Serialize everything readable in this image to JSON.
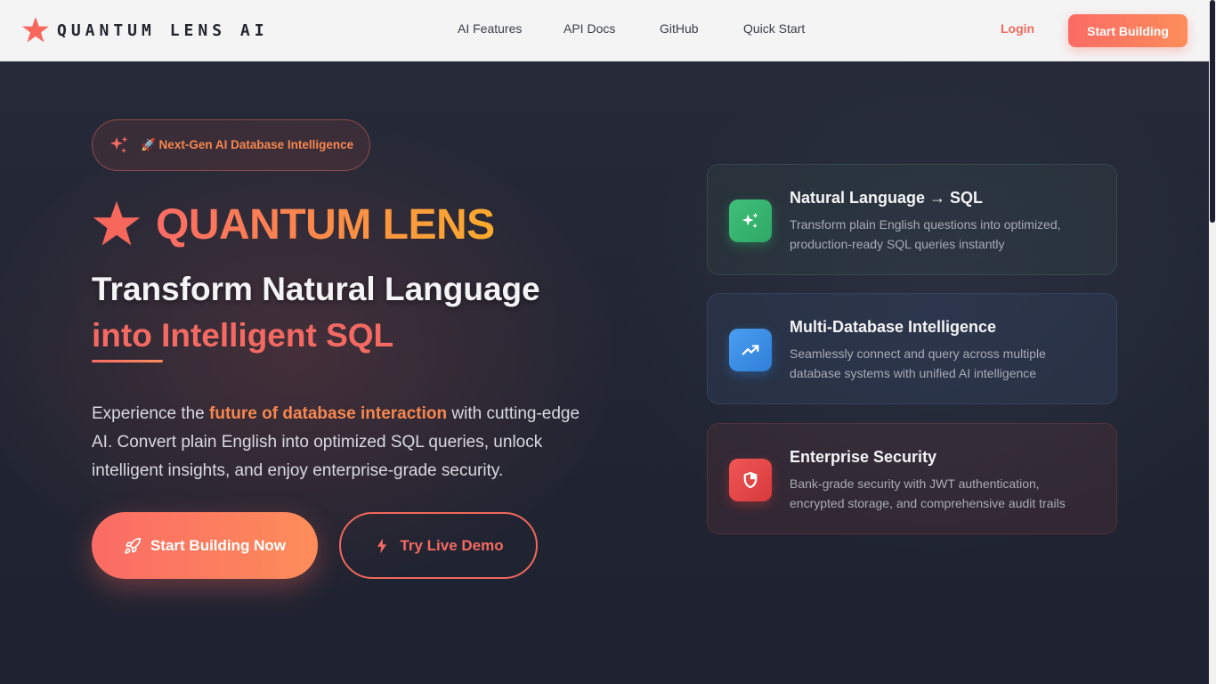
{
  "brand": {
    "name": "QUANTUM LENS AI"
  },
  "nav": {
    "links": [
      "AI Features",
      "API Docs",
      "GitHub",
      "Quick Start"
    ],
    "login": "Login",
    "cta": "Start Building"
  },
  "hero": {
    "badge": "🚀 Next-Gen AI Database Intelligence",
    "title": "QUANTUM LENS",
    "headline_line1": "Transform Natural Language",
    "headline_line2": "into Intelligent SQL",
    "desc_before": "Experience the ",
    "desc_highlight": "future of database interaction",
    "desc_after": " with cutting-edge AI. Convert plain English into optimized SQL queries, unlock intelligent insights, and enjoy enterprise-grade security.",
    "primary_button": "Start Building Now",
    "secondary_button": "Try Live Demo"
  },
  "features": [
    {
      "title": "Natural Language → SQL",
      "text": "Transform plain English questions into optimized, production-ready SQL queries instantly",
      "icon": "sparkles-icon",
      "color": "#3fbf7a"
    },
    {
      "title": "Multi-Database Intelligence",
      "text": "Seamlessly connect and query across multiple database systems with unified AI intelligence",
      "icon": "trending-up-icon",
      "color": "#4a9ef0"
    },
    {
      "title": "Enterprise Security",
      "text": "Bank-grade security with JWT authentication, encrypted storage, and comprehensive audit trails",
      "icon": "shield-icon",
      "color": "#f05656"
    }
  ],
  "colors": {
    "accent": "#fb6b65",
    "accent2": "#fd8d5a",
    "background": "#1f2330",
    "navbar": "#f4f4f5"
  }
}
